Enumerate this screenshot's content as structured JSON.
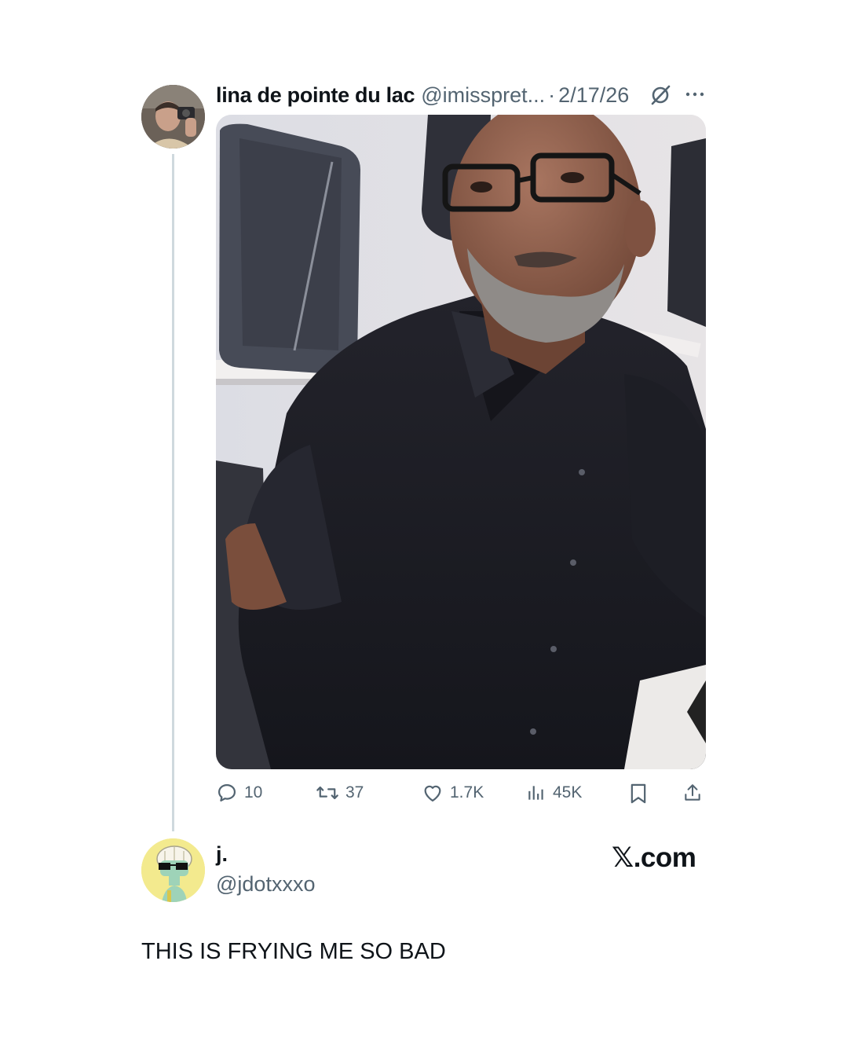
{
  "tweet": {
    "author": {
      "display_name": "lina de pointe du lac",
      "handle": "@imisspret...",
      "avatar": "avatar-man-pointing-camera"
    },
    "separator": "·",
    "date": "2/17/26",
    "icons": {
      "grok": "grok-icon",
      "more": "more-icon"
    },
    "media": {
      "description_icon": "photo"
    },
    "stats": {
      "replies": "10",
      "retweets": "37",
      "likes": "1.7K",
      "views": "45K"
    }
  },
  "reply": {
    "author": {
      "display_name": "j.",
      "handle": "@jdotxxxo",
      "avatar": "avatar-cartoon-squid-sunglasses"
    },
    "text": "THIS IS FRYING ME SO BAD"
  },
  "watermark": {
    "x_glyph": "𝕏",
    "domain": ".com"
  },
  "colors": {
    "text_primary": "#0f1419",
    "text_secondary": "#536471",
    "thread_line": "#cfd9de",
    "background": "#ffffff"
  }
}
